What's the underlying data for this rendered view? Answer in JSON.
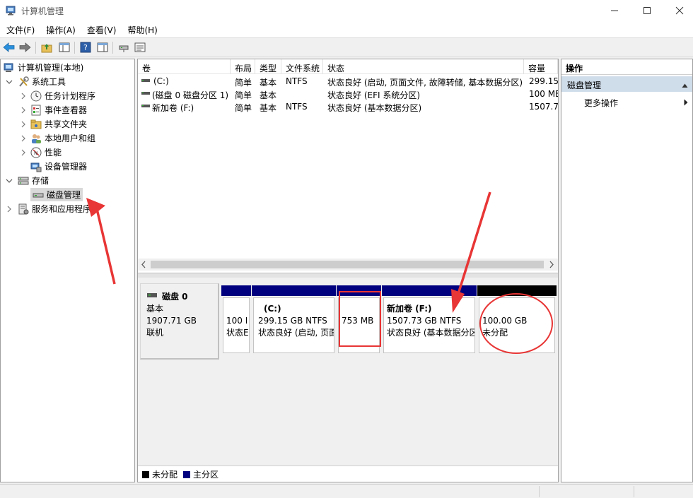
{
  "window": {
    "title": "计算机管理"
  },
  "menu": [
    "文件(F)",
    "操作(A)",
    "查看(V)",
    "帮助(H)"
  ],
  "tree": {
    "root": "计算机管理(本地)",
    "system_tools": "系统工具",
    "task_scheduler": "任务计划程序",
    "event_viewer": "事件查看器",
    "shared_folders": "共享文件夹",
    "local_users": "本地用户和组",
    "performance": "性能",
    "device_manager": "设备管理器",
    "storage": "存储",
    "disk_management": "磁盘管理",
    "services": "服务和应用程序"
  },
  "volumes": {
    "headers": [
      "卷",
      "布局",
      "类型",
      "文件系统",
      "状态",
      "容量"
    ],
    "rows": [
      [
        "(C:)",
        "简单",
        "基本",
        "NTFS",
        "状态良好 (启动, 页面文件, 故障转储, 基本数据分区)",
        "299.15"
      ],
      [
        "(磁盘 0 磁盘分区 1)",
        "简单",
        "基本",
        "",
        "状态良好 (EFI 系统分区)",
        "100 ME"
      ],
      [
        "新加卷 (F:)",
        "简单",
        "基本",
        "NTFS",
        "状态良好 (基本数据分区)",
        "1507.73"
      ]
    ]
  },
  "disk0": {
    "name": "磁盘 0",
    "type": "基本",
    "size": "1907.71 GB",
    "status": "联机",
    "partitions": [
      {
        "line1": "",
        "line2": "100 I",
        "line3": "状态E"
      },
      {
        "line1": "(C:)",
        "line2": "299.15 GB NTFS",
        "line3": "状态良好 (启动, 页面"
      },
      {
        "line1": "",
        "line2": "753 MB",
        "line3": ""
      },
      {
        "line1": "新加卷  (F:)",
        "line2": "1507.73 GB NTFS",
        "line3": "状态良好 (基本数据分区"
      },
      {
        "line1": "",
        "line2": "100.00 GB",
        "line3": "未分配"
      }
    ]
  },
  "legend": {
    "unallocated": "未分配",
    "primary": "主分区"
  },
  "colors": {
    "primary": "#00007f",
    "unallocated": "#000000",
    "annotation": "#e83535",
    "selected_header": "#cfdcea"
  },
  "actions_panel": {
    "title": "操作",
    "section": "磁盘管理",
    "more": "更多操作"
  }
}
